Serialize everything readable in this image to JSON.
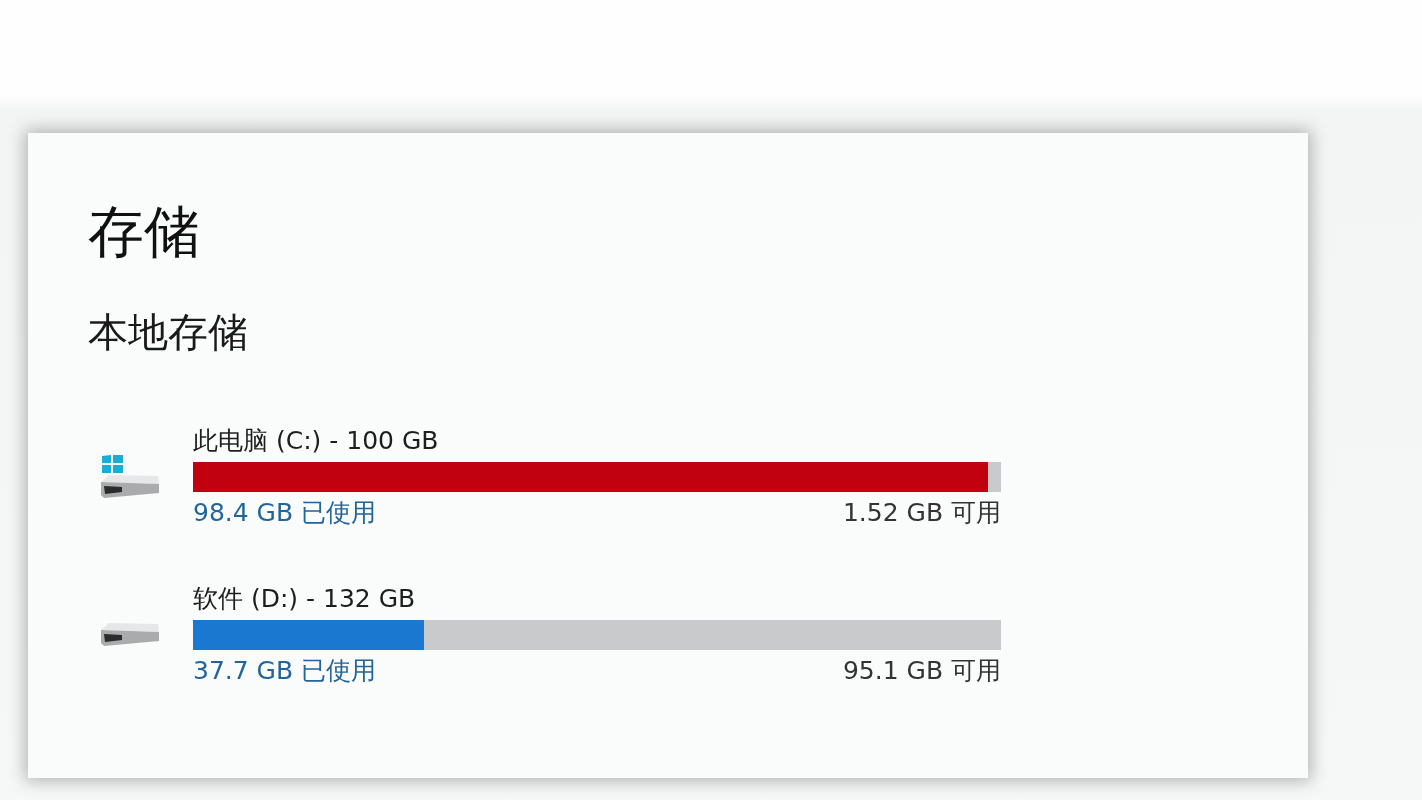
{
  "page": {
    "title": "存储"
  },
  "section": {
    "title": "本地存储"
  },
  "drives": [
    {
      "kind": "system",
      "label": "此电脑 (C:) - 100 GB",
      "level": 0.984,
      "color": "#c10010",
      "used": "98.4 GB 已使用",
      "free": "1.52 GB 可用"
    },
    {
      "kind": "plain",
      "label": "软件 (D:) - 132 GB",
      "level": 0.286,
      "color": "#1a78d0",
      "used": "37.7 GB 已使用",
      "free": "95.1 GB 可用"
    }
  ]
}
